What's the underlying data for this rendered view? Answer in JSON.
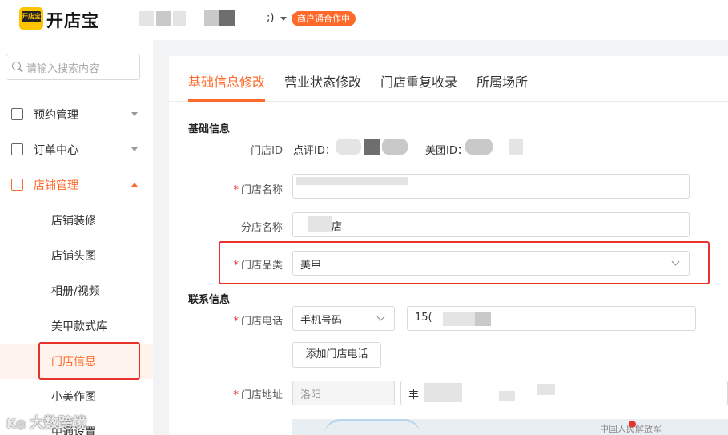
{
  "header": {
    "app_name": "开店宝",
    "logo_mark": "开店宝",
    "account_tail": ";)",
    "status_badge": "商户通合作中",
    "accent": "#ff6a2b"
  },
  "sidebar": {
    "search_placeholder": "请输入搜索内容",
    "items": [
      {
        "label": "预约管理",
        "icon": "calendar-check-icon"
      },
      {
        "label": "订单中心",
        "icon": "clipboard-icon"
      },
      {
        "label": "店铺管理",
        "icon": "store-icon"
      }
    ],
    "sub_items": [
      {
        "label": "店铺装修"
      },
      {
        "label": "店铺头图"
      },
      {
        "label": "相册/视频"
      },
      {
        "label": "美甲款式库"
      },
      {
        "label": "门店信息"
      },
      {
        "label": "小美作图"
      },
      {
        "label": "中通设置"
      }
    ]
  },
  "main": {
    "tabs": [
      {
        "label": "基础信息修改"
      },
      {
        "label": "营业状态修改"
      },
      {
        "label": "门店重复收录"
      },
      {
        "label": "所属场所"
      }
    ],
    "basic_section": "基础信息",
    "store_id_label": "门店ID",
    "dianping_id_label": "点评ID：",
    "meituan_id_label": "美团ID：",
    "required_mark": "*",
    "store_name_label": "门店名称",
    "store_name_value": "",
    "branch_name_label": "分店名称",
    "branch_name_tail": "店",
    "category_label": "门店品类",
    "category_value": "美甲",
    "contact_section": "联系信息",
    "phone_label": "门店电话",
    "phone_type": "手机号码",
    "phone_prefix": "15(",
    "add_phone_button": "添加门店电话",
    "address_label": "门店地址",
    "city_value": "洛阳",
    "street_prefix": "丰",
    "map_label": "中国人民解放军"
  },
  "watermark": "大数跨境"
}
